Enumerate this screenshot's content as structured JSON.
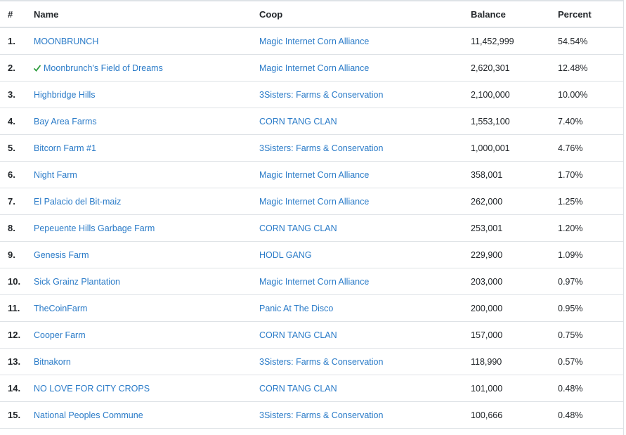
{
  "header": {
    "rank": "#",
    "name": "Name",
    "coop": "Coop",
    "balance": "Balance",
    "percent": "Percent"
  },
  "colors": {
    "link": "#2a7bc8",
    "check": "#2e9e3e",
    "border": "#dee2e6"
  },
  "rows": [
    {
      "rank": "1.",
      "name": "MOONBRUNCH",
      "coop": "Magic Internet Corn Alliance",
      "balance": "11,452,999",
      "percent": "54.54%",
      "icon": ""
    },
    {
      "rank": "2.",
      "name": "Moonbrunch's Field of Dreams",
      "coop": "Magic Internet Corn Alliance",
      "balance": "2,620,301",
      "percent": "12.48%",
      "icon": "checkmark-icon"
    },
    {
      "rank": "3.",
      "name": "Highbridge Hills",
      "coop": "3Sisters: Farms & Conservation",
      "balance": "2,100,000",
      "percent": "10.00%",
      "icon": ""
    },
    {
      "rank": "4.",
      "name": "Bay Area Farms",
      "coop": "CORN TANG CLAN",
      "balance": "1,553,100",
      "percent": "7.40%",
      "icon": ""
    },
    {
      "rank": "5.",
      "name": "Bitcorn Farm #1",
      "coop": "3Sisters: Farms & Conservation",
      "balance": "1,000,001",
      "percent": "4.76%",
      "icon": ""
    },
    {
      "rank": "6.",
      "name": "Night Farm",
      "coop": "Magic Internet Corn Alliance",
      "balance": "358,001",
      "percent": "1.70%",
      "icon": ""
    },
    {
      "rank": "7.",
      "name": "El Palacio del Bit-maiz",
      "coop": "Magic Internet Corn Alliance",
      "balance": "262,000",
      "percent": "1.25%",
      "icon": ""
    },
    {
      "rank": "8.",
      "name": "Pepeuente Hills Garbage Farm",
      "coop": "CORN TANG CLAN",
      "balance": "253,001",
      "percent": "1.20%",
      "icon": ""
    },
    {
      "rank": "9.",
      "name": "Genesis Farm",
      "coop": "HODL GANG",
      "balance": "229,900",
      "percent": "1.09%",
      "icon": ""
    },
    {
      "rank": "10.",
      "name": "Sick Grainz Plantation",
      "coop": "Magic Internet Corn Alliance",
      "balance": "203,000",
      "percent": "0.97%",
      "icon": ""
    },
    {
      "rank": "11.",
      "name": "TheCoinFarm",
      "coop": "Panic At The Disco",
      "balance": "200,000",
      "percent": "0.95%",
      "icon": ""
    },
    {
      "rank": "12.",
      "name": "Cooper Farm",
      "coop": "CORN TANG CLAN",
      "balance": "157,000",
      "percent": "0.75%",
      "icon": ""
    },
    {
      "rank": "13.",
      "name": "Bitnakorn",
      "coop": "3Sisters: Farms & Conservation",
      "balance": "118,990",
      "percent": "0.57%",
      "icon": ""
    },
    {
      "rank": "14.",
      "name": "NO LOVE FOR CITY CROPS",
      "coop": "CORN TANG CLAN",
      "balance": "101,000",
      "percent": "0.48%",
      "icon": ""
    },
    {
      "rank": "15.",
      "name": "National Peoples Commune",
      "coop": "3Sisters: Farms & Conservation",
      "balance": "100,666",
      "percent": "0.48%",
      "icon": ""
    }
  ]
}
